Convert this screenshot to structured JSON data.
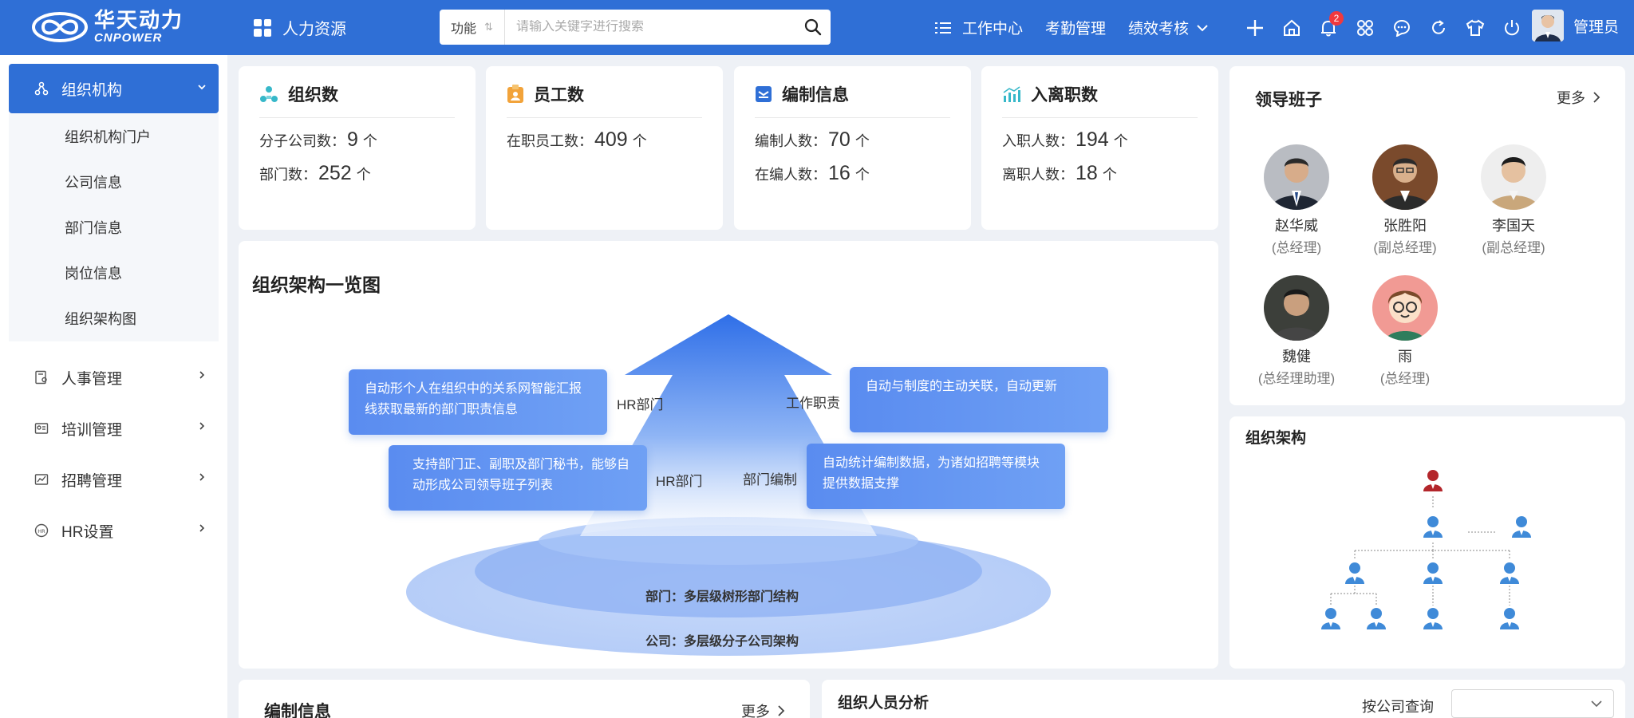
{
  "brand": {
    "cn": "华天动力",
    "en": "CNPOWER"
  },
  "module": {
    "label": "人力资源"
  },
  "search": {
    "type_label": "功能",
    "placeholder": "请输入关键字进行搜索"
  },
  "nav": {
    "items": [
      "工作中心",
      "考勤管理",
      "绩效考核"
    ]
  },
  "notifications": {
    "count": "2"
  },
  "user": {
    "name": "管理员"
  },
  "sidebar": {
    "active": "组织机构",
    "submenu": [
      "组织机构门户",
      "公司信息",
      "部门信息",
      "岗位信息",
      "组织架构图"
    ],
    "items": [
      "人事管理",
      "培训管理",
      "招聘管理",
      "HR设置"
    ]
  },
  "stats": [
    {
      "title": "组织数",
      "rows": [
        {
          "label": "分子公司数：",
          "value": "9",
          "unit": "个"
        },
        {
          "label": "部门数：",
          "value": "252",
          "unit": "个"
        }
      ]
    },
    {
      "title": "员工数",
      "rows": [
        {
          "label": "在职员工数：",
          "value": "409",
          "unit": "个"
        }
      ]
    },
    {
      "title": "编制信息",
      "rows": [
        {
          "label": "编制人数：",
          "value": "70",
          "unit": "个"
        },
        {
          "label": "在编人数：",
          "value": "16",
          "unit": "个"
        }
      ]
    },
    {
      "title": "入离职数",
      "rows": [
        {
          "label": "入职人数：",
          "value": "194",
          "unit": "个"
        },
        {
          "label": "离职人数：",
          "value": "18",
          "unit": "个"
        }
      ]
    }
  ],
  "overview": {
    "title": "组织架构一览图",
    "boxes": [
      "自动形个人在组织中的关系网智能汇报线获取最新的部门职责信息",
      "自动与制度的主动关联，自动更新",
      "支持部门正、副职及部门秘书，能够自动形成公司领导班子列表",
      "自动统计编制数据，为诸如招聘等模块提供数据支撑"
    ],
    "labels": [
      "HR部门",
      "工作职责",
      "HR部门",
      "部门编制"
    ],
    "layers": [
      "部门：多层级树形部门结构",
      "公司：多层级分子公司架构"
    ]
  },
  "leaders": {
    "title": "领导班子",
    "more": "更多",
    "people": [
      {
        "name": "赵华威",
        "role": "(总经理)"
      },
      {
        "name": "张胜阳",
        "role": "(副总经理)"
      },
      {
        "name": "李国天",
        "role": "(副总经理)"
      },
      {
        "name": "魏健",
        "role": "(总经理助理)"
      },
      {
        "name": "雨",
        "role": "(总经理)"
      }
    ]
  },
  "org_chart": {
    "title": "组织架构"
  },
  "staffing": {
    "title": "编制信息",
    "more": "更多"
  },
  "analysis": {
    "title": "组织人员分析",
    "filter_label": "按公司查询"
  },
  "colors": {
    "primary": "#2f6fd6",
    "background": "#eef1f6",
    "badge": "#f0393e"
  }
}
